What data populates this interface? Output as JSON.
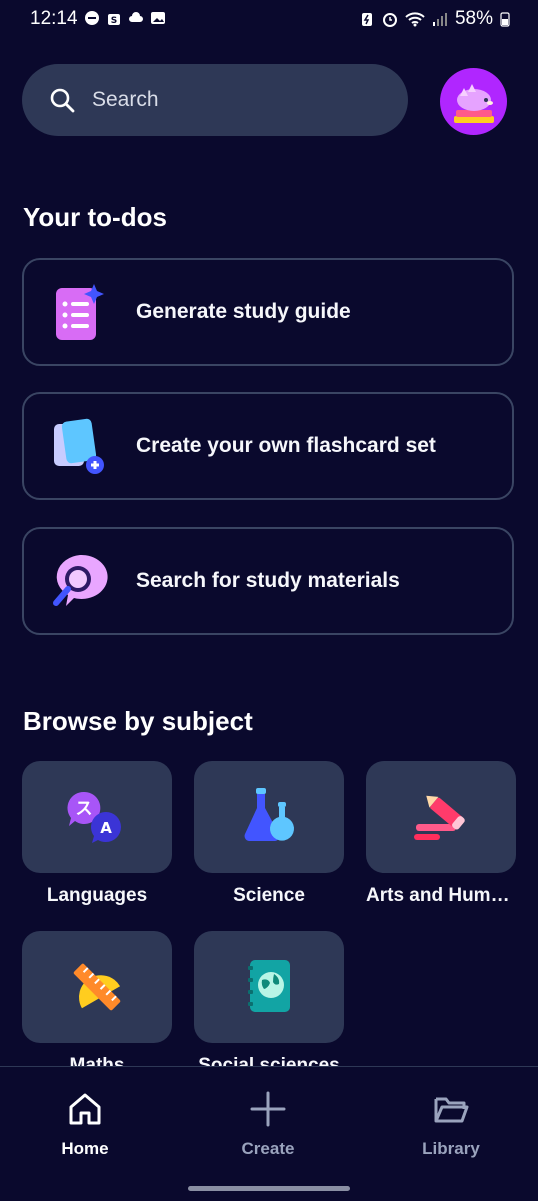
{
  "status_bar": {
    "time": "12:14",
    "battery": "58%"
  },
  "search": {
    "placeholder": "Search"
  },
  "todos": {
    "title": "Your to-dos",
    "items": [
      {
        "label": "Generate study guide",
        "icon": "study-guide-icon"
      },
      {
        "label": "Create your own flashcard set",
        "icon": "flashcard-add-icon"
      },
      {
        "label": "Search for study materials",
        "icon": "magnifier-bubble-icon"
      }
    ]
  },
  "browse": {
    "title": "Browse by subject",
    "subjects": [
      {
        "label": "Languages",
        "icon": "languages-icon"
      },
      {
        "label": "Science",
        "icon": "flask-icon"
      },
      {
        "label": "Arts and Humanities",
        "icon": "pencil-icon"
      },
      {
        "label": "Maths",
        "icon": "ruler-protractor-icon"
      },
      {
        "label": "Social sciences",
        "icon": "globe-book-icon"
      }
    ]
  },
  "nav": {
    "home": "Home",
    "create": "Create",
    "library": "Library"
  },
  "colors": {
    "background": "#0a092d",
    "card": "#2e3856",
    "card_border": "#3a4563",
    "text": "#ffffff",
    "muted": "#9aa3bd"
  }
}
